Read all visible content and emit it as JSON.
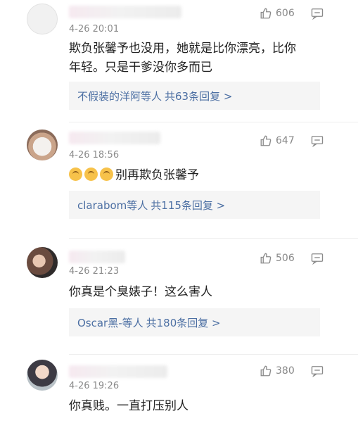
{
  "comments": [
    {
      "name_visible": "",
      "time": "4-26 20:01",
      "likes": "606",
      "text_lines": [
        "欺负张馨予也没用，她就是比你漂亮，比你",
        "年轻。只是干爹没你多而已"
      ],
      "reply_user": "不假装的洋阿等人",
      "reply_count": "共63条回复 >"
    },
    {
      "name_visible": "",
      "time": "4-26 18:56",
      "likes": "647",
      "text": "别再欺负张馨予",
      "reply_user": "clarabom等人",
      "reply_count": "共115条回复 >"
    },
    {
      "name_visible": "",
      "time": "4-26 21:23",
      "likes": "506",
      "text": "你真是个臭婊子！这么害人",
      "reply_user": "Oscar黑-等人",
      "reply_count": "共180条回复 >"
    },
    {
      "name_visible": "",
      "time": "4-26 19:26",
      "likes": "380",
      "text": "你真贱。一直打压别人"
    }
  ],
  "icons": {
    "like": "thumbs-up-icon",
    "reply": "comment-reply-icon",
    "emoji": "upside-down-face-emoji"
  },
  "colors": {
    "link": "#4c6fa3",
    "meta": "#8a8a8a",
    "reply_bg": "#f5f5f5"
  }
}
